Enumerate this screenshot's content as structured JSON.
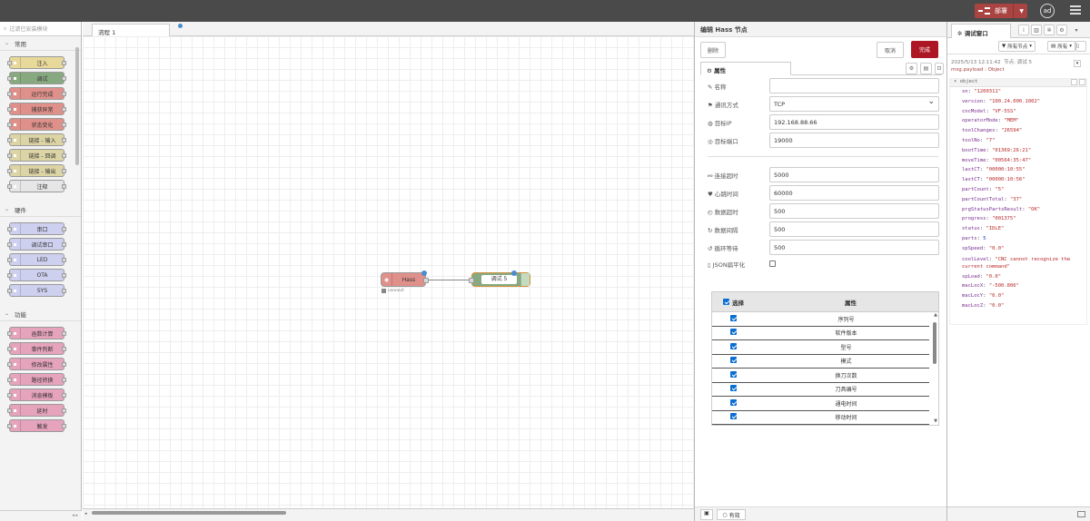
{
  "header": {
    "deploy_label": "部署"
  },
  "palette": {
    "search_placeholder": "过滤已安装模块",
    "categories": [
      {
        "label": "常用",
        "nodes": [
          {
            "label": "注入",
            "color": "#e7d99a"
          },
          {
            "label": "调试",
            "color": "#87a980"
          },
          {
            "label": "运行完成",
            "color": "#e0908a"
          },
          {
            "label": "捕获异常",
            "color": "#e0908a"
          },
          {
            "label": "状态变化",
            "color": "#e0908a"
          },
          {
            "label": "链接 - 输入",
            "color": "#ddd4a6"
          },
          {
            "label": "链接 - 回调",
            "color": "#ddd4a6"
          },
          {
            "label": "链接 - 输出",
            "color": "#ddd4a6"
          },
          {
            "label": "注释",
            "color": "#e6e6e6"
          }
        ]
      },
      {
        "label": "硬件",
        "nodes": [
          {
            "label": "串口",
            "color": "#cdd0ee"
          },
          {
            "label": "调试串口",
            "color": "#cdd0ee"
          },
          {
            "label": "LED",
            "color": "#cdd0ee"
          },
          {
            "label": "OTA",
            "color": "#cdd0ee"
          },
          {
            "label": "SYS",
            "color": "#cdd0ee"
          }
        ]
      },
      {
        "label": "功能",
        "nodes": [
          {
            "label": "函数计算",
            "color": "#e6a3bc"
          },
          {
            "label": "事件判断",
            "color": "#e6a3bc"
          },
          {
            "label": "修改属性",
            "color": "#e6a3bc"
          },
          {
            "label": "路径转换",
            "color": "#e6a3bc"
          },
          {
            "label": "消息模板",
            "color": "#e6a3bc"
          },
          {
            "label": "延时",
            "color": "#e6a3bc"
          },
          {
            "label": "触发",
            "color": "#e6a3bc"
          }
        ]
      }
    ]
  },
  "workspace": {
    "tab_label": "流程 1",
    "hass_node_label": "Hass",
    "hass_status": "connect",
    "debug_node_label": "调试 5"
  },
  "editor": {
    "title": "编辑 Hass 节点",
    "delete_label": "删除",
    "cancel_label": "取消",
    "done_label": "完成",
    "tab_label": "属性",
    "fields": {
      "name_label": "名称",
      "name_value": "",
      "protocol_label": "通讯方式",
      "protocol_value": "TCP",
      "ip_label": "目标IP",
      "ip_value": "192.168.88.66",
      "port_label": "目标端口",
      "port_value": "19000",
      "conn_timeout_label": "连接超时",
      "conn_timeout_value": "5000",
      "heartbeat_label": "心跳时间",
      "heartbeat_value": "60000",
      "data_timeout_label": "数据超时",
      "data_timeout_value": "500",
      "data_interval_label": "数据间隔",
      "data_interval_value": "500",
      "loop_wait_label": "循环等待",
      "loop_wait_value": "500",
      "json_label": "JSON扁平化"
    },
    "table": {
      "col_select": "选择",
      "col_attr": "属性",
      "rows": [
        "序列号",
        "软件版本",
        "型号",
        "模式",
        "换刀次数",
        "刀具编号",
        "通电时间",
        "移动时间"
      ]
    },
    "footer_label": "有效"
  },
  "sidebar": {
    "tab_label": "调试窗口",
    "filter_nodes": "所有节点",
    "filter_all": "所有",
    "msg_time": "2025/5/13 12:11:42",
    "msg_node": "节点: 调试 5",
    "msg_topic": "msg.payload : Object",
    "object_label": "object",
    "entries": [
      {
        "k": "sn",
        "v": "\"1200311\"",
        "t": "s"
      },
      {
        "k": "version",
        "v": "\"100.24.000.1002\"",
        "t": "s"
      },
      {
        "k": "cncModel",
        "v": "\"VF-5SS\"",
        "t": "s"
      },
      {
        "k": "operatorMode",
        "v": "\"MEM\"",
        "t": "s"
      },
      {
        "k": "toolChanges",
        "v": "\"26594\"",
        "t": "s"
      },
      {
        "k": "toolNo",
        "v": "\"7\"",
        "t": "s"
      },
      {
        "k": "bootTime",
        "v": "\"01369:26:21\"",
        "t": "s"
      },
      {
        "k": "moveTime",
        "v": "\"00564:35:47\"",
        "t": "s"
      },
      {
        "k": "lastCT",
        "v": "\"00000:10:55\"",
        "t": "s"
      },
      {
        "k": "lastCT",
        "v": "\"00000:10:56\"",
        "t": "s"
      },
      {
        "k": "partCount",
        "v": "\"5\"",
        "t": "s"
      },
      {
        "k": "partCountTotal",
        "v": "\"37\"",
        "t": "s"
      },
      {
        "k": "prgStatusPartsResult",
        "v": "\"OK\"",
        "t": "s"
      },
      {
        "k": "progress",
        "v": "\"001375\"",
        "t": "s"
      },
      {
        "k": "status",
        "v": "\"IDLE\"",
        "t": "s"
      },
      {
        "k": "parts",
        "v": "5",
        "t": "n"
      },
      {
        "k": "spSpeed",
        "v": "\"0.0\"",
        "t": "s"
      },
      {
        "k": "coolLevel",
        "v": "\"CNC cannot recognize the current command\"",
        "t": "s",
        "wrap": true
      },
      {
        "k": "spLoad",
        "v": "\"0.0\"",
        "t": "s"
      },
      {
        "k": "macLocX",
        "v": "\"-500.806\"",
        "t": "s"
      },
      {
        "k": "macLocY",
        "v": "\"0.0\"",
        "t": "s"
      },
      {
        "k": "macLocZ",
        "v": "\"0.0\"",
        "t": "s"
      }
    ]
  }
}
